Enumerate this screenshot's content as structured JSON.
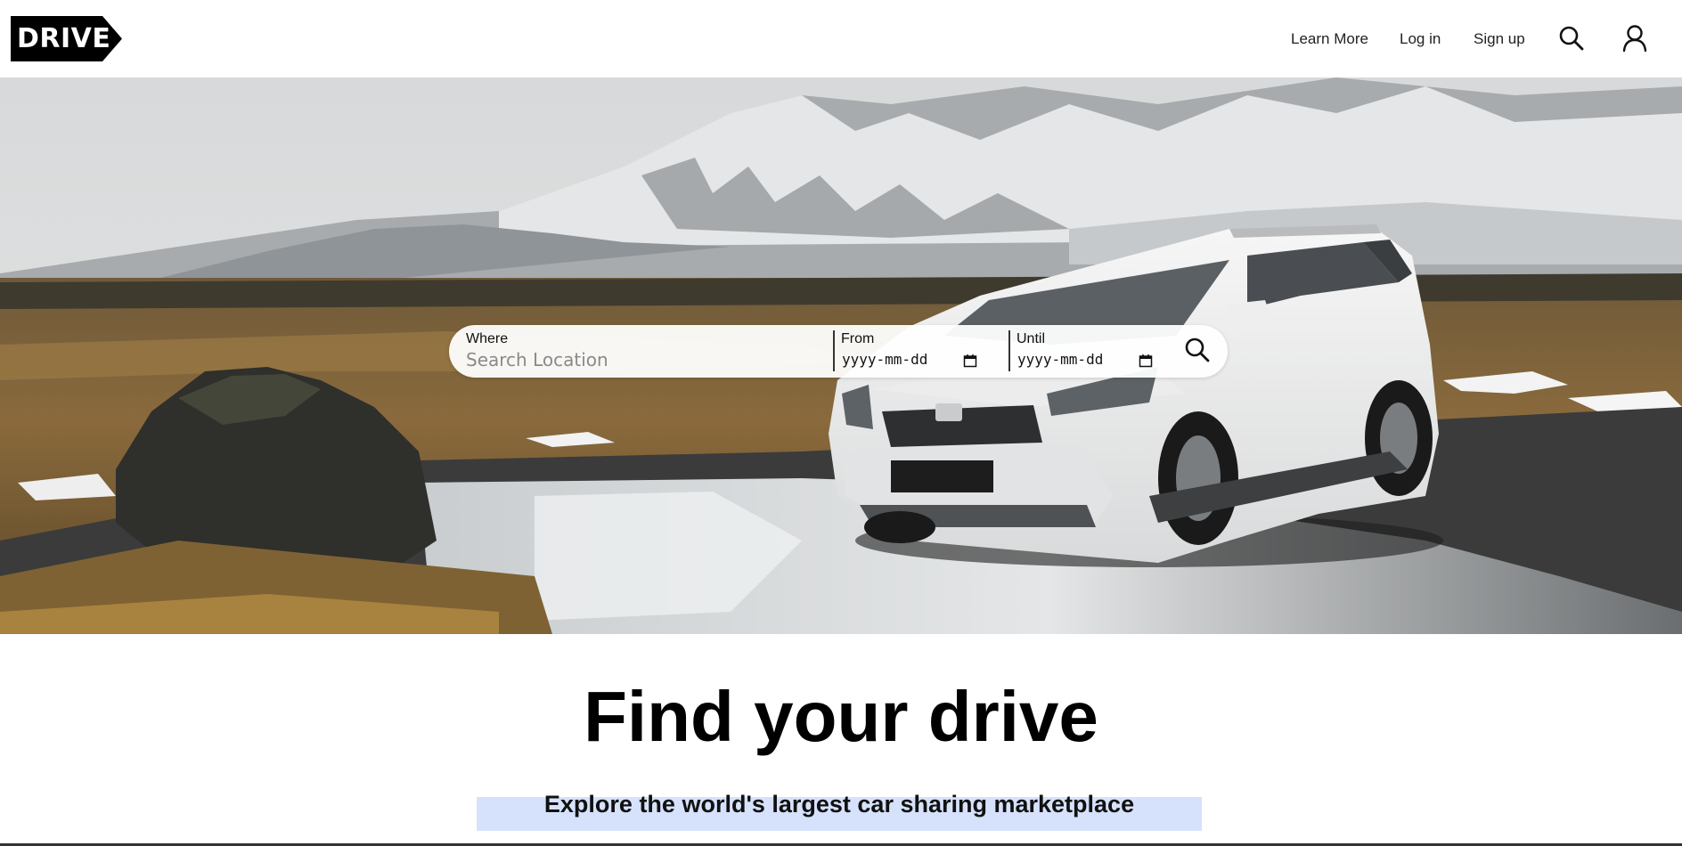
{
  "header": {
    "logo_text": "DRIVE",
    "nav": {
      "learn_more": "Learn More",
      "log_in": "Log in",
      "sign_up": "Sign up"
    },
    "icons": {
      "search": "search-icon",
      "user": "user-icon"
    }
  },
  "search": {
    "where_label": "Where",
    "where_placeholder": "Search Location",
    "from_label": "From",
    "from_value": "yyyy-mm-dd",
    "until_label": "Until",
    "until_value": "yyyy-mm-dd",
    "button_icon": "search-icon"
  },
  "main": {
    "headline": "Find your drive",
    "subheadline": "Explore the world's largest car sharing marketplace"
  },
  "colors": {
    "logo_bg": "#000000",
    "highlight": "#d6e2fb",
    "text": "#111111"
  }
}
